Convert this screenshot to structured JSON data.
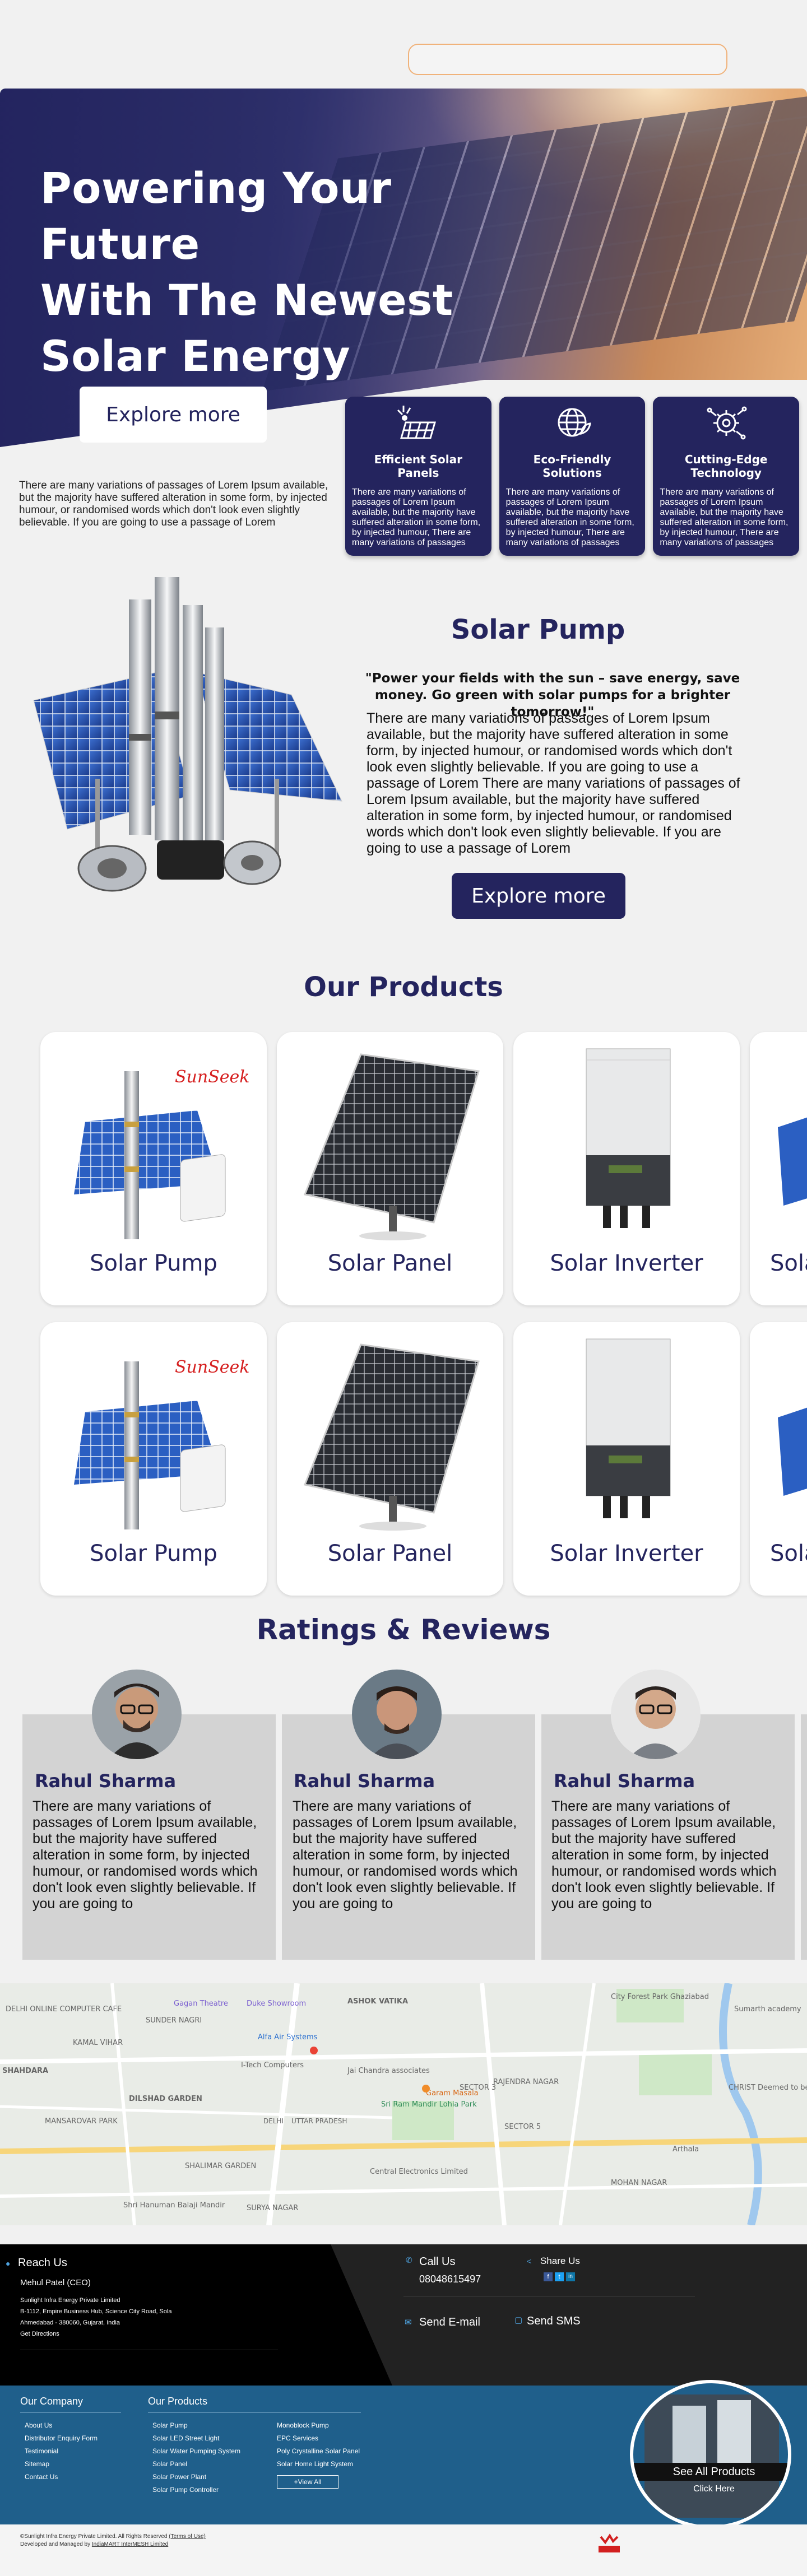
{
  "hero": {
    "title_line1": "Powering Your Future",
    "title_line2": "With The Newest",
    "title_line3": "Solar Energy",
    "button": "Explore more",
    "paragraph": "There are many variations of passages of Lorem Ipsum available, but the majority have suffered alteration in some form, by injected humour, or randomised words which don't look even slightly believable. If you are going to use a passage of Lorem"
  },
  "features": [
    {
      "icon": "solar-panel-icon",
      "title": "Efficient Solar Panels",
      "text": "There are many variations of passages of Lorem Ipsum available, but the majority have suffered alteration in some form, by injected humour, There are many variations of passages"
    },
    {
      "icon": "globe-leaf-icon",
      "title": "Eco-Friendly Solutions",
      "text": "There are many variations of passages of Lorem Ipsum available, but the majority have suffered alteration in some form, by injected humour, There are many variations of passages"
    },
    {
      "icon": "gear-tech-icon",
      "title": "Cutting-Edge Technology",
      "text": "There are many variations of passages of Lorem Ipsum available, but the majority have suffered alteration in some form, by injected humour, There are many variations of passages"
    }
  ],
  "pump": {
    "title": "Solar Pump",
    "quote": "\"Power your fields with the sun – save energy, save money. Go green with solar pumps for a brighter tomorrow!\"",
    "body": "There are many variations of passages of Lorem Ipsum available, but the majority have suffered alteration in some form, by injected humour, or randomised words which don't look even slightly believable. If you are going to use a passage of Lorem There are many variations of passages of Lorem Ipsum available, but the majority have suffered alteration in some form, by injected humour, or randomised words which don't look even slightly believable. If you are going to use a passage of Lorem",
    "button": "Explore more"
  },
  "products": {
    "title": "Our Products",
    "row1": [
      "Solar Pump",
      "Solar Panel",
      "Solar Inverter",
      "Sola"
    ],
    "row2": [
      "Solar Pump",
      "Solar Panel",
      "Solar Inverter",
      "Sola"
    ],
    "brand": "SunSeeker"
  },
  "reviews": {
    "title": "Ratings & Reviews",
    "items": [
      {
        "name": "Rahul Sharma",
        "text": "There are many variations of passages of Lorem Ipsum available, but the majority have suffered alteration in some form, by injected humour, or randomised words which don't look even slightly believable. If you are going to"
      },
      {
        "name": "Rahul Sharma",
        "text": "There are many variations of passages of Lorem Ipsum available, but the majority have suffered alteration in some form, by injected humour, or randomised words which don't look even slightly believable. If you are going to"
      },
      {
        "name": "Rahul Sharma",
        "text": "There are many variations of passages of Lorem Ipsum available, but the majority have suffered alteration in some form, by injected humour, or randomised words which don't look even slightly believable. If you are going to"
      }
    ]
  },
  "map": {
    "labels": [
      "City Forest Park Ghaziabad",
      "Sumarth academy",
      "ASHOK VATIKA",
      "Duke Showroom",
      "Gagan Theatre",
      "Alfa Air Systems",
      "DELHI ONLINE COMPUTER CAFE",
      "SUNDER NAGRI",
      "KAMAL VIHAR",
      "SHAHDARA",
      "DILSHAD GARDEN",
      "MANSAROVAR PARK",
      "I-Tech Computers",
      "Jai Chandra associates",
      "Sri Ram Mandir Lohia Park",
      "Garam Masala",
      "RAJENDRA NAGAR",
      "SECTOR 3",
      "SECTOR 5",
      "CHRIST Deemed to be University Delhi NCR",
      "SHALIMAR GARDEN",
      "Arthala",
      "Central Electronics Limited",
      "MOHAN NAGAR",
      "Shri Hanuman Balaji Mandir",
      "SURYA NAGAR",
      "DELHI",
      "UTTAR PRADESH"
    ]
  },
  "contact": {
    "reach_title": "Reach Us",
    "person": "Mehul Patel (CEO)",
    "company": "Sunlight Infra Energy Private Limited",
    "address1": "B-1112, Empire Business Hub, Science City Road, Sola",
    "address2": "Ahmedabad - 380060, Gujarat, India",
    "directions": "Get Directions",
    "call_title": "Call Us",
    "phone": "08048615497",
    "share_title": "Share Us",
    "email": "Send E-mail",
    "sms": "Send SMS"
  },
  "footer": {
    "company_title": "Our Company",
    "company_links": [
      "About Us",
      "Distributor Enquiry Form",
      "Testimonial",
      "Sitemap",
      "Contact Us"
    ],
    "products_title": "Our Products",
    "products_col1": [
      "Solar Pump",
      "Solar LED Street Light",
      "Solar Water Pumping System",
      "Solar Panel",
      "Solar Power Plant",
      "Solar Pump Controller"
    ],
    "products_col2": [
      "Monoblock Pump",
      "EPC Services",
      "Poly Crystalline Solar Panel",
      "Solar Home Light System"
    ],
    "view_all": "+View All",
    "see_all": "See All Products",
    "click_here": "Click Here"
  },
  "bottom": {
    "copyright": "©Sunlight Infra Energy Private Limited. All Rights Reserved",
    "terms": "(Terms of Use)",
    "developed": "Developed and Managed by",
    "dev_link": "IndiaMART InterMESH Limited"
  },
  "colors": {
    "navy": "#24245e",
    "footer_blue": "#1f5f8b",
    "accent_orange": "#f0b27a"
  }
}
